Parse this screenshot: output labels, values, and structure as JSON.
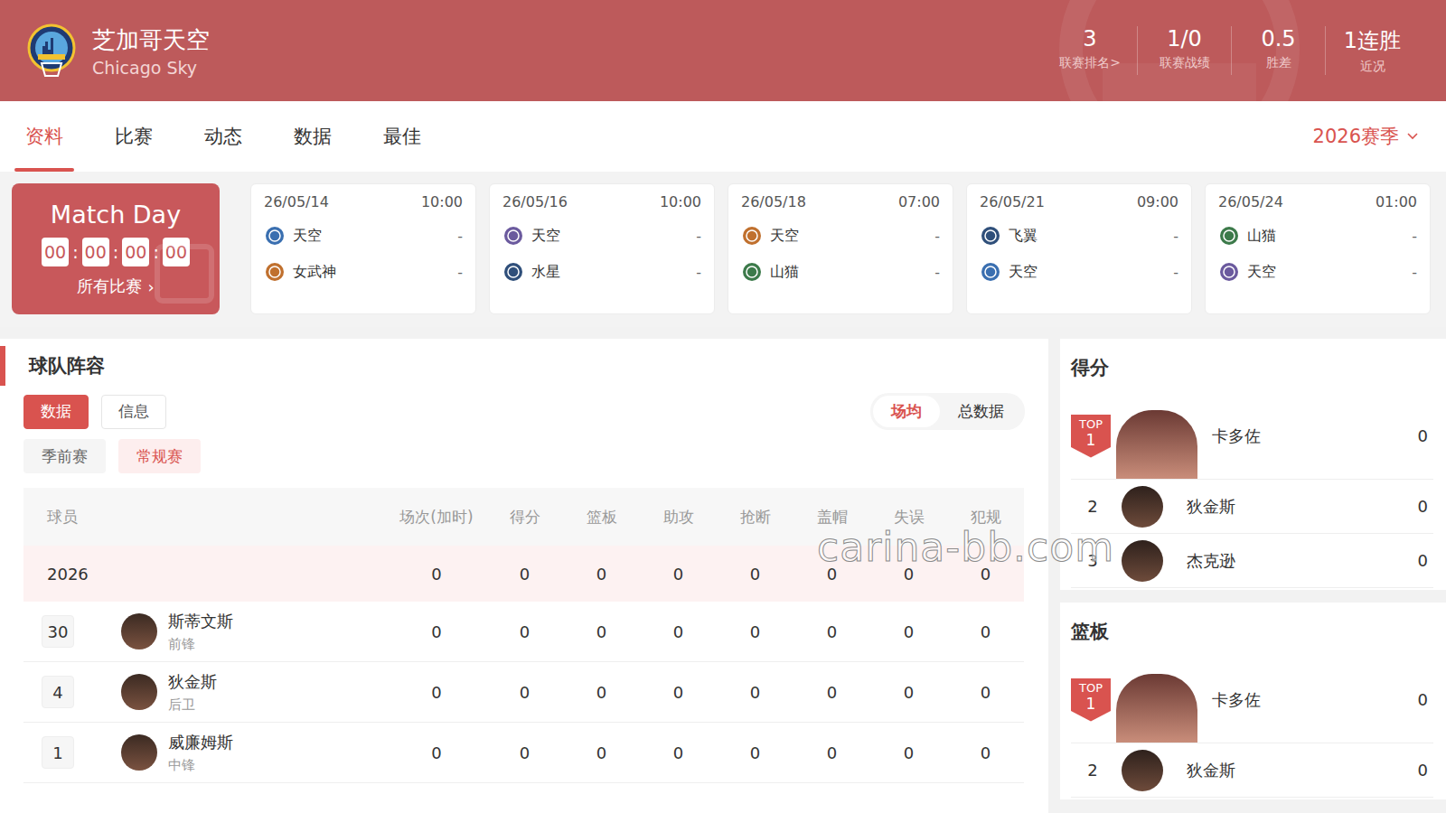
{
  "header": {
    "name_cn": "芝加哥天空",
    "name_en": "Chicago Sky",
    "stats": [
      {
        "value": "3",
        "label": "联赛排名>"
      },
      {
        "value": "1/0",
        "label": "联赛战绩"
      },
      {
        "value": "0.5",
        "label": "胜差"
      },
      {
        "value": "1连胜",
        "label": "近况"
      }
    ]
  },
  "tabs": [
    {
      "label": "资料",
      "selected": true
    },
    {
      "label": "比赛",
      "selected": false
    },
    {
      "label": "动态",
      "selected": false
    },
    {
      "label": "数据",
      "selected": false
    },
    {
      "label": "最佳",
      "selected": false
    }
  ],
  "season": "2026赛季",
  "match_day": {
    "title": "Match Day",
    "countdown": [
      "00",
      "00",
      "00",
      "00"
    ],
    "separator": ":",
    "link": "所有比赛",
    "link_arrow": "›"
  },
  "matches": [
    {
      "date": "26/05/14",
      "time": "10:00",
      "teams": [
        {
          "name": "天空",
          "score": "-"
        },
        {
          "name": "女武神",
          "score": "-"
        }
      ]
    },
    {
      "date": "26/05/16",
      "time": "10:00",
      "teams": [
        {
          "name": "天空",
          "score": "-"
        },
        {
          "name": "水星",
          "score": "-"
        }
      ]
    },
    {
      "date": "26/05/18",
      "time": "07:00",
      "teams": [
        {
          "name": "天空",
          "score": "-"
        },
        {
          "name": "山猫",
          "score": "-"
        }
      ]
    },
    {
      "date": "26/05/21",
      "time": "09:00",
      "teams": [
        {
          "name": "飞翼",
          "score": "-"
        },
        {
          "name": "天空",
          "score": "-"
        }
      ]
    },
    {
      "date": "26/05/24",
      "time": "01:00",
      "teams": [
        {
          "name": "山猫",
          "score": "-"
        },
        {
          "name": "天空",
          "score": "-"
        }
      ]
    }
  ],
  "roster": {
    "title": "球队阵容",
    "view_tabs": [
      {
        "label": "数据",
        "selected": true
      },
      {
        "label": "信息",
        "selected": false
      }
    ],
    "mode_tabs": [
      {
        "label": "场均",
        "selected": true
      },
      {
        "label": "总数据",
        "selected": false
      }
    ],
    "phase_tabs": [
      {
        "label": "季前赛",
        "selected": false
      },
      {
        "label": "常规赛",
        "selected": true
      }
    ],
    "columns": [
      "球员",
      "场次(加时)",
      "得分",
      "篮板",
      "助攻",
      "抢断",
      "盖帽",
      "失误",
      "犯规"
    ],
    "total": {
      "label": "2026",
      "values": [
        "0",
        "0",
        "0",
        "0",
        "0",
        "0",
        "0",
        "0"
      ]
    },
    "players": [
      {
        "number": "30",
        "name": "斯蒂文斯",
        "position": "前锋",
        "values": [
          "0",
          "0",
          "0",
          "0",
          "0",
          "0",
          "0",
          "0"
        ]
      },
      {
        "number": "4",
        "name": "狄金斯",
        "position": "后卫",
        "values": [
          "0",
          "0",
          "0",
          "0",
          "0",
          "0",
          "0",
          "0"
        ]
      },
      {
        "number": "1",
        "name": "威廉姆斯",
        "position": "中锋",
        "values": [
          "0",
          "0",
          "0",
          "0",
          "0",
          "0",
          "0",
          "0"
        ]
      }
    ]
  },
  "leaders": [
    {
      "title": "得分",
      "entries": [
        {
          "kind": "top",
          "badge": "TOP",
          "rank": "1",
          "name": "卡多佐",
          "value": "0"
        },
        {
          "kind": "normal",
          "rank": "2",
          "name": "狄金斯",
          "value": "0"
        },
        {
          "kind": "normal",
          "rank": "3",
          "name": "杰克逊",
          "value": "0"
        }
      ]
    },
    {
      "title": "篮板",
      "entries": [
        {
          "kind": "top",
          "badge": "TOP",
          "rank": "1",
          "name": "卡多佐",
          "value": "0"
        },
        {
          "kind": "normal",
          "rank": "2",
          "name": "狄金斯",
          "value": "0"
        }
      ]
    }
  ],
  "watermark": "carina-bb.com"
}
